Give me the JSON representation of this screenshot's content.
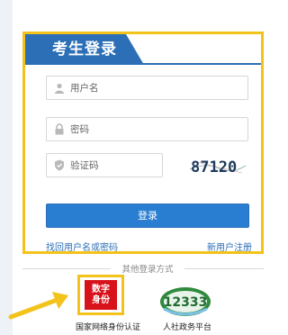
{
  "login": {
    "title": "考生登录",
    "username_placeholder": "用户名",
    "password_placeholder": "密码",
    "captcha_placeholder": "验证码",
    "captcha_text": "87120",
    "login_button": "登录",
    "forgot_link": "找回用户名或密码",
    "register_link": "新用户注册"
  },
  "other_login": {
    "label": "其他登录方式",
    "options": [
      {
        "logo_text_line1": "数字",
        "logo_text_line2": "身份",
        "caption": "国家网络身份认证"
      },
      {
        "logo_text": "12333",
        "caption": "人社政务平台"
      }
    ]
  },
  "colors": {
    "primary_blue": "#2c6fb6",
    "highlight_yellow": "#f3c21b",
    "logo_red": "#d7121a",
    "hr_green": "#2f8a3e"
  }
}
